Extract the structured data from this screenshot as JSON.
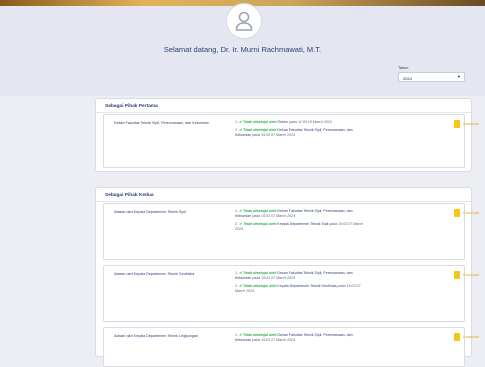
{
  "welcome": "Selamat datang, Dr. Ir. Murni Rachmawati, M.T.",
  "tahun": {
    "label": "Tahun",
    "value": "2024"
  },
  "download_label": "Download",
  "sections": [
    {
      "title": "Sebagai Pihak Pertama",
      "items": [
        {
          "title": "Dekan Fakultas Teknik Sipil, Perencanaan, dan Kebumian",
          "logs": [
            {
              "num": "1.",
              "status": "✔ Telah disetujui oleh",
              "actor": "Rektor",
              "time": "pada 11:05:19 March 2024"
            },
            {
              "num": "2.",
              "status": "✔ Telah disetujui oleh",
              "actor": "Dekan Fakultas Teknik Sipil, Perencanaan, dan Kebumian",
              "time": "pada 15:03 07 March 2024"
            }
          ]
        }
      ]
    },
    {
      "title": "Sebagai Pihak Kedua",
      "items": [
        {
          "title": "Atasan dari Kepala Departemen Teknik Sipil",
          "logs": [
            {
              "num": "1.",
              "status": "✔ Telah disetujui oleh",
              "actor": "Dekan Fakultas Teknik Sipil, Perencanaan, dan Kebumian",
              "time": "pada 15:03 07 March 2024"
            },
            {
              "num": "2.",
              "status": "✔ Telah disetujui oleh",
              "actor": "Kepala Departemen Teknik Sipil",
              "time": "pada 15:03 07 March 2024"
            }
          ]
        },
        {
          "title": "Atasan dari Kepala Departemen Teknik Geofisika",
          "logs": [
            {
              "num": "1.",
              "status": "✔ Telah disetujui oleh",
              "actor": "Dekan Fakultas Teknik Sipil, Perencanaan, dan Kebumian",
              "time": "pada 15:03 07 March 2024"
            },
            {
              "num": "2.",
              "status": "✔ Telah disetujui oleh",
              "actor": "Kepala Departemen Teknik Geofisika",
              "time": "pada 15:03 07 March 2024"
            }
          ]
        },
        {
          "title": "Atasan dari Kepala Departemen Teknik Lingkungan",
          "logs": [
            {
              "num": "1.",
              "status": "✔ Telah disetujui oleh",
              "actor": "Dekan Fakultas Teknik Sipil, Perencanaan, dan Kebumian",
              "time": "pada 15:03 07 March 2024"
            }
          ]
        }
      ]
    }
  ]
}
